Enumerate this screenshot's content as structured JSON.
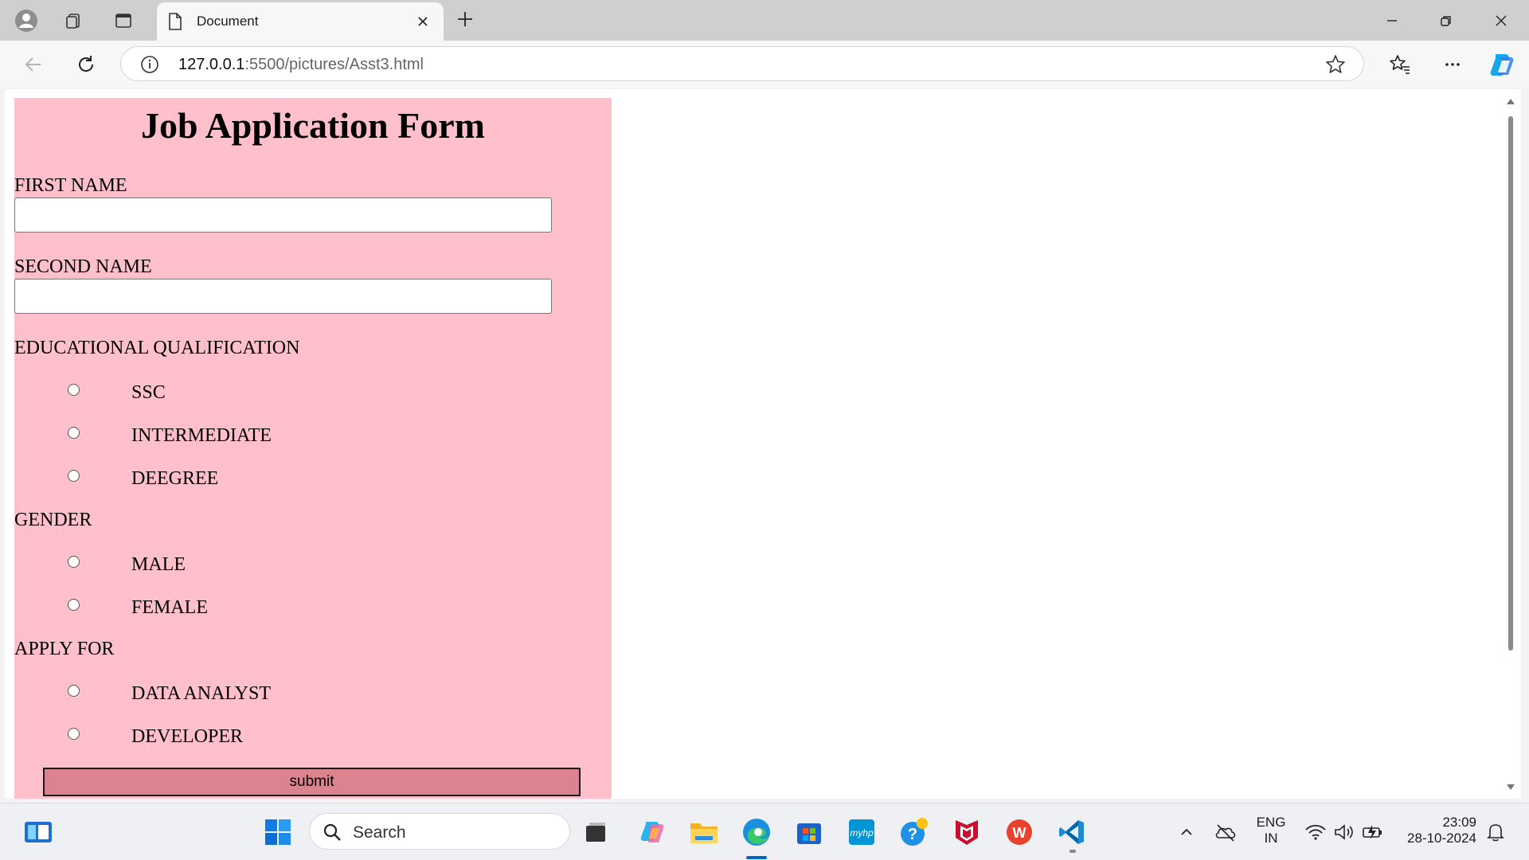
{
  "browser": {
    "tab_title": "Document",
    "url_host": "127.0.0.1",
    "url_rest": ":5500/pictures/Asst3.html",
    "icons": [
      "profile-icon",
      "workspaces-icon",
      "tab-actions-icon",
      "page-icon",
      "close-icon",
      "plus-icon",
      "minimize-icon",
      "restore-icon",
      "back-icon",
      "refresh-icon",
      "info-icon",
      "star-icon",
      "favorites-icon",
      "more-icon",
      "copilot-icon"
    ]
  },
  "form": {
    "title": "Job Application Form",
    "first_name_label": "FIRST NAME",
    "first_name_value": "",
    "second_name_label": "SECOND NAME",
    "second_name_value": "",
    "education_label": "EDUCATIONAL QUALIFICATION",
    "education_options": [
      "SSC",
      "INTERMEDIATE",
      "DEEGREE"
    ],
    "gender_label": "GENDER",
    "gender_options": [
      "MALE",
      "FEMALE"
    ],
    "apply_label": "APPLY FOR",
    "apply_options": [
      "DATA ANALYST",
      "DEVELOPER"
    ],
    "submit_label": "submit",
    "bg_color": "#ffc0cb",
    "button_color": "#db8490"
  },
  "taskbar": {
    "search_label": "Search",
    "lang_line1": "ENG",
    "lang_line2": "IN",
    "time": "23:09",
    "date": "28-10-2024",
    "app_icons": [
      "widgets-icon",
      "windows-start-icon",
      "search-icon",
      "task-view-icon",
      "copilot-icon",
      "file-explorer-icon",
      "edge-icon",
      "store-icon",
      "myhp-icon",
      "tips-icon",
      "mcafee-icon",
      "wps-office-icon",
      "vscode-icon"
    ],
    "tray_icons": [
      "chevron-up-icon",
      "onedrive-icon",
      "wifi-icon",
      "volume-icon",
      "battery-icon",
      "notification-bell-icon"
    ]
  }
}
